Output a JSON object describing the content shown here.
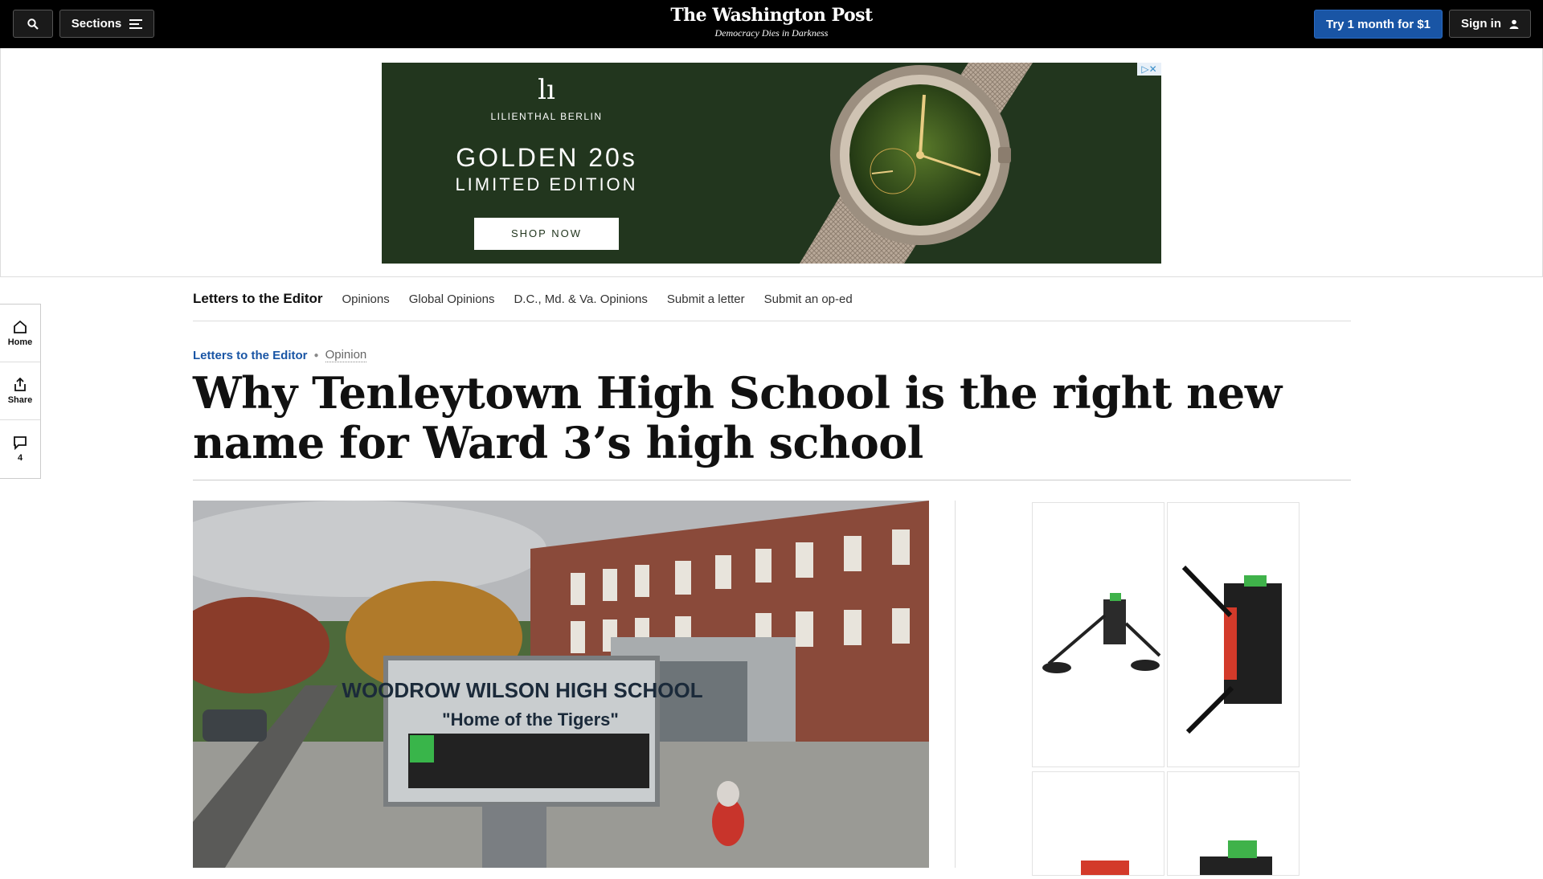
{
  "header": {
    "sections_label": "Sections",
    "logo_name": "The Washington Post",
    "logo_tagline": "Democracy Dies in Darkness",
    "try_label": "Try 1 month for $1",
    "signin_label": "Sign in"
  },
  "top_ad": {
    "brand": "LILIENTHAL BERLIN",
    "headline": "GOLDEN 20s",
    "subheadline": "LIMITED EDITION",
    "cta": "SHOP NOW"
  },
  "rail": {
    "home": "Home",
    "share": "Share",
    "comments_count": "4"
  },
  "subnav": {
    "title": "Letters to the Editor",
    "links": [
      "Opinions",
      "Global Opinions",
      "D.C., Md. & Va. Opinions",
      "Submit a letter",
      "Submit an op-ed"
    ]
  },
  "article": {
    "kicker_section": "Letters to the Editor",
    "kicker_type": "Opinion",
    "headline": "Why Tenleytown High School is the right new name for Ward 3’s high school"
  },
  "hero_image": {
    "sign_line1": "WOODROW WILSON HIGH SCHOOL",
    "sign_line2": "\"Home of the Tigers\""
  },
  "colors": {
    "accent": "#1955a5",
    "topbar": "#000000",
    "ad_green": "#22361e"
  }
}
